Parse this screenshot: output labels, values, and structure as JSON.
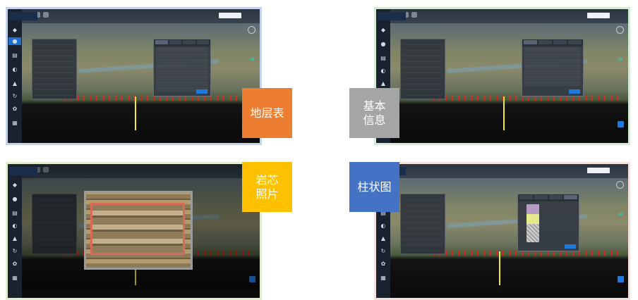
{
  "labels": {
    "stratigraphy_table": "地层表",
    "basic_info": "基本\n信息",
    "core_photo": "岩芯\n照片",
    "column_chart": "柱状图"
  },
  "colors": {
    "stratigraphy_table": "#ed7d31",
    "basic_info": "#a5a5a5",
    "core_photo": "#ffc000",
    "column_chart": "#4472c4"
  }
}
